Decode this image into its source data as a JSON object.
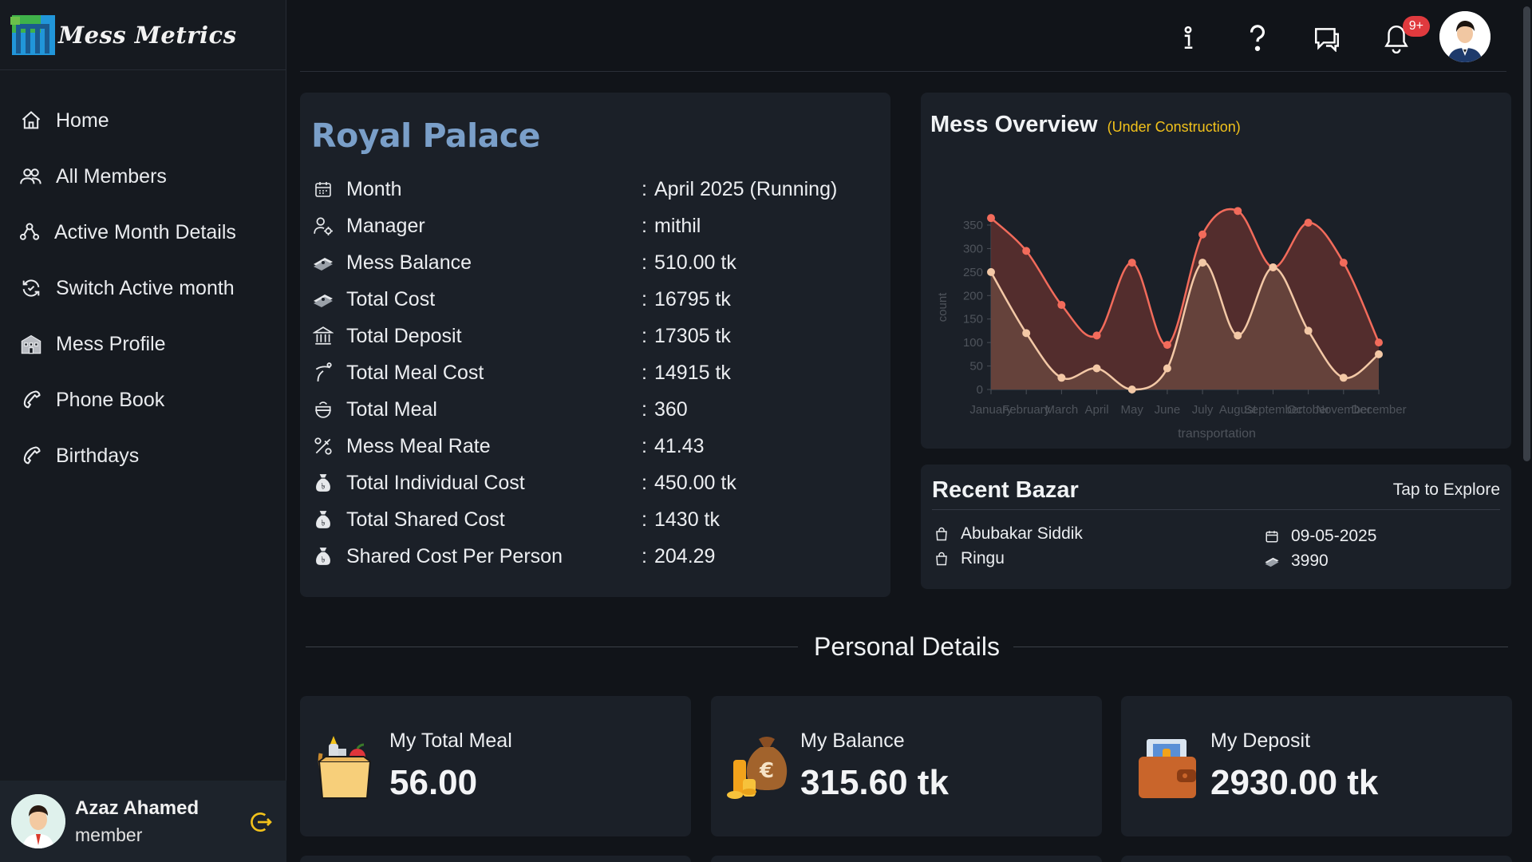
{
  "app": {
    "name": "Mess Metrics"
  },
  "sidebar": {
    "items": [
      {
        "label": "Home",
        "icon": "home-icon"
      },
      {
        "label": "All Members",
        "icon": "users-icon"
      },
      {
        "label": "Active Month Details",
        "icon": "chart-icon"
      },
      {
        "label": "Switch Active month",
        "icon": "refresh-icon"
      },
      {
        "label": "Mess Profile",
        "icon": "building-icon"
      },
      {
        "label": "Phone Book",
        "icon": "phone-icon"
      },
      {
        "label": "Birthdays",
        "icon": "phone-icon"
      }
    ],
    "user": {
      "name": "Azaz Ahamed",
      "role": "member"
    }
  },
  "topbar": {
    "notification_badge": "9+"
  },
  "mess": {
    "name": "Royal Palace",
    "rows": [
      {
        "label": "Month",
        "value": "April 2025 (Running)",
        "icon": "calendar-icon"
      },
      {
        "label": "Manager",
        "value": "mithil",
        "icon": "user-gear-icon"
      },
      {
        "label": "Mess Balance",
        "value": " 510.00 tk",
        "icon": "money-icon"
      },
      {
        "label": "Total Cost",
        "value": " 16795 tk",
        "icon": "money-icon"
      },
      {
        "label": "Total Deposit",
        "value": " 17305 tk",
        "icon": "bank-icon"
      },
      {
        "label": "Total Meal Cost",
        "value": " 14915 tk",
        "icon": "hand-coin-icon"
      },
      {
        "label": "Total Meal",
        "value": " 360",
        "icon": "meal-icon"
      },
      {
        "label": "Mess Meal Rate",
        "value": " 41.43",
        "icon": "percent-icon"
      },
      {
        "label": "Total Individual Cost",
        "value": " 450.00 tk",
        "icon": "money-bag-icon"
      },
      {
        "label": "Total Shared Cost",
        "value": " 1430 tk",
        "icon": "money-bag-icon"
      },
      {
        "label": "Shared Cost Per Person",
        "value": " 204.29",
        "icon": "money-bag-icon"
      }
    ]
  },
  "overview": {
    "title": "Mess Overview",
    "subtitle": "(Under Construction)"
  },
  "chart_data": {
    "type": "area",
    "xlabel": "transportation",
    "ylabel": "count",
    "categories": [
      "January",
      "February",
      "March",
      "April",
      "May",
      "June",
      "July",
      "August",
      "September",
      "October",
      "November",
      "December"
    ],
    "yticks": [
      0,
      50,
      100,
      150,
      200,
      250,
      300,
      350
    ],
    "ylim": [
      0,
      350
    ],
    "series": [
      {
        "values": [
          365,
          295,
          180,
          115,
          270,
          95,
          330,
          380,
          260,
          355,
          270,
          100
        ],
        "color": "#f26b5b"
      },
      {
        "values": [
          250,
          120,
          25,
          45,
          0,
          45,
          270,
          115,
          260,
          125,
          25,
          75
        ],
        "color": "#f3c8a6"
      }
    ],
    "grid": false
  },
  "bazar": {
    "title": "Recent Bazar",
    "explore": "Tap to Explore",
    "shoppers": [
      "Abubakar Siddik",
      "Ringu"
    ],
    "date": "09-05-2025",
    "amount": "3990"
  },
  "personal": {
    "title": "Personal Details",
    "cards": [
      {
        "label": "My Total Meal",
        "value": "56.00"
      },
      {
        "label": "My Balance",
        "value": "315.60 tk"
      },
      {
        "label": "My Deposit",
        "value": "2930.00 tk"
      }
    ]
  }
}
